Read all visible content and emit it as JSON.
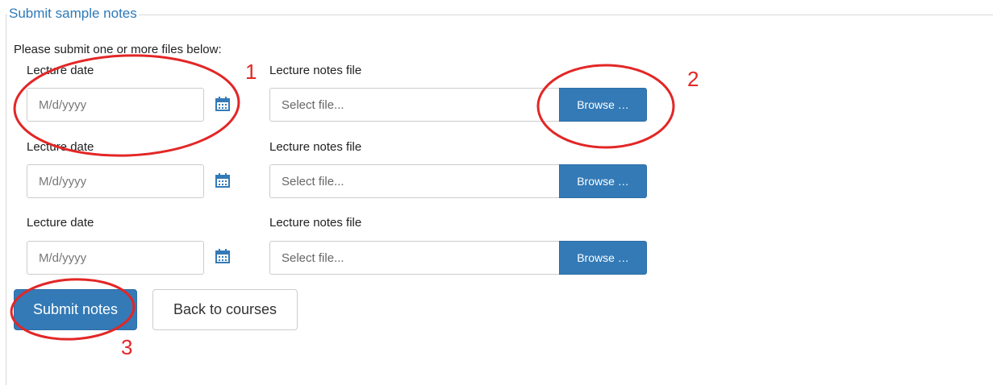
{
  "form": {
    "legend": "Submit sample notes",
    "intro": "Please submit one or more files below:",
    "rows": [
      {
        "date_label": "Lecture date",
        "date_placeholder": "M/d/yyyy",
        "file_label": "Lecture notes file",
        "file_placeholder": "Select file...",
        "browse_label": "Browse …"
      },
      {
        "date_label": "Lecture date",
        "date_placeholder": "M/d/yyyy",
        "file_label": "Lecture notes file",
        "file_placeholder": "Select file...",
        "browse_label": "Browse …"
      },
      {
        "date_label": "Lecture date",
        "date_placeholder": "M/d/yyyy",
        "file_label": "Lecture notes file",
        "file_placeholder": "Select file...",
        "browse_label": "Browse …"
      }
    ],
    "submit_label": "Submit notes",
    "back_label": "Back to courses"
  },
  "icons": {
    "calendar": "calendar-icon"
  },
  "annotations": [
    "1",
    "2",
    "3"
  ],
  "colors": {
    "primary": "#337ab7",
    "legend": "#2e7ab8",
    "annotation": "#e32626"
  }
}
